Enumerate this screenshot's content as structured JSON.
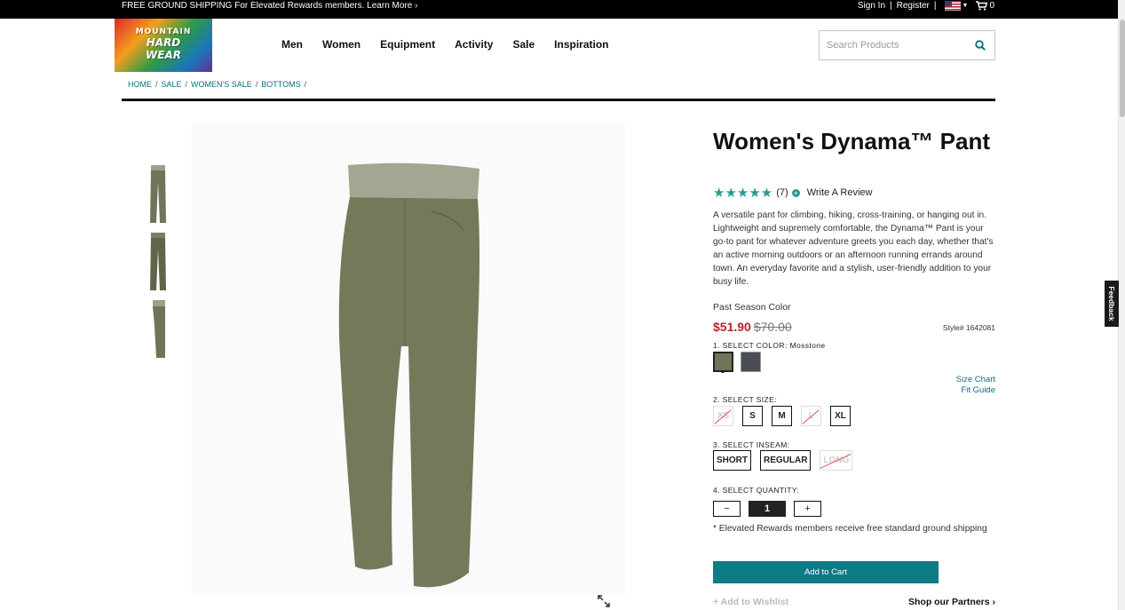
{
  "topbar": {
    "promo": "FREE GROUND SHIPPING For Elevated Rewards members. Learn More ›",
    "sign_in": "Sign In",
    "sep1": "|",
    "register": "Register",
    "sep2": "|",
    "cart_count": "0"
  },
  "logo": {
    "line1": "MOUNTAIN",
    "line2": "HARD",
    "line3": "WEAR"
  },
  "nav": [
    "Men",
    "Women",
    "Equipment",
    "Activity",
    "Sale",
    "Inspiration"
  ],
  "search": {
    "placeholder": "Search Products"
  },
  "breadcrumb": [
    "HOME",
    "SALE",
    "WOMEN'S SALE",
    "BOTTOMS"
  ],
  "breadcrumb_sep": "/",
  "product": {
    "title": "Women's Dynama™ Pant",
    "stars": "★★★★★",
    "review_count": "(7)",
    "review_plus": "+",
    "write_review": "Write A Review",
    "description": "A versatile pant for climbing, hiking, cross-training, or hanging out in. Lightweight and supremely comfortable, the Dynama™ Pant is your go-to pant for whatever adventure greets you each day, whether that's an active morning outdoors or an afternoon running errands around town. An everyday favorite and a stylish, user-friendly addition to your busy life.",
    "past_season": "Past Season Color",
    "price_sale": "$51.90",
    "price_original": "$70.00",
    "style": "Style# 1642081",
    "select_color_label": "1. SELECT COLOR:",
    "selected_color": "Mosstone",
    "colors": [
      "#6f7558",
      "#4a4d52"
    ],
    "size_chart": "Size Chart",
    "fit_guide": "Fit Guide",
    "select_size_label": "2. SELECT SIZE:",
    "sizes": [
      {
        "label": "XS",
        "available": false
      },
      {
        "label": "S",
        "available": true
      },
      {
        "label": "M",
        "available": true
      },
      {
        "label": "L",
        "available": false
      },
      {
        "label": "XL",
        "available": true
      }
    ],
    "select_inseam_label": "3. SELECT INSEAM:",
    "inseams": [
      {
        "label": "SHORT",
        "available": true
      },
      {
        "label": "REGULAR",
        "available": true
      },
      {
        "label": "LONG",
        "available": false
      }
    ],
    "select_qty_label": "4. SELECT QUANTITY:",
    "qty_minus": "−",
    "qty_value": "1",
    "qty_plus": "+",
    "shipping_note": "* Elevated Rewards members receive free standard ground shipping",
    "add_to_cart": "Add to Cart",
    "add_to_wishlist": "+ Add to Wishlist",
    "shop_partners": "Shop our Partners ›"
  },
  "zoom": {
    "plus": "+",
    "minus": "−",
    "reset": "↺"
  },
  "feedback": "Feedback"
}
